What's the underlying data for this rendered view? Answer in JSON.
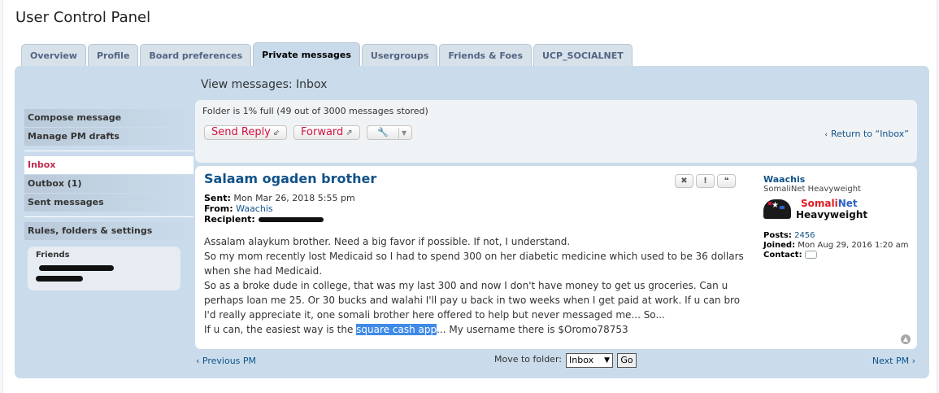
{
  "page": {
    "title": "User Control Panel"
  },
  "tabs": [
    {
      "label": "Overview"
    },
    {
      "label": "Profile"
    },
    {
      "label": "Board preferences"
    },
    {
      "label": "Private messages",
      "active": true
    },
    {
      "label": "Usergroups"
    },
    {
      "label": "Friends & Foes"
    },
    {
      "label": "UCP_SOCIALNET"
    }
  ],
  "sidebar": {
    "items": [
      {
        "label": "Compose message"
      },
      {
        "label": "Manage PM drafts"
      },
      {
        "label": "Inbox",
        "active": true
      },
      {
        "label": "Outbox (1)"
      },
      {
        "label": "Sent messages"
      },
      {
        "label": "Rules, folders & settings"
      }
    ],
    "friends_title": "Friends"
  },
  "main": {
    "view_title": "View messages: Inbox",
    "folder_status": "Folder is 1% full (49 out of 3000 messages stored)",
    "send_reply_label": "Send Reply",
    "forward_label": "Forward",
    "return_label": "Return to “Inbox”"
  },
  "message": {
    "subject": "Salaam ogaden brother",
    "sent_label": "Sent:",
    "sent_value": "Mon Mar 26, 2018 5:55 pm",
    "from_label": "From:",
    "from_value": "Waachis",
    "recipient_label": "Recipient:",
    "lines": [
      "Assalam alaykum brother. Need a big favor if possible. If not, I understand.",
      "So my mom recently lost Medicaid so I had to spend 300 on her diabetic medicine which used to be 36 dollars when she had Medicaid.",
      "So as a broke dude in college, that was my last 300 and now I don't have money to get us groceries. Can u perhaps loan me 25. Or 30 bucks and walahi I'll pay u back in two weeks when I get paid at work. If u can bro I'd really appreciate it, one somali brother here offered to help but never messaged me... So..."
    ],
    "last_line_before": "If u can, the easiest way is the ",
    "last_line_highlight": "square cash app",
    "last_line_after": "... My username there is $Oromo78753"
  },
  "profile": {
    "username": "Waachis",
    "rank": "SomaliNet Heavyweight",
    "rank_image_line1_a": "Somali",
    "rank_image_line1_b": "Net",
    "rank_image_line2": "Heavyweight",
    "posts_label": "Posts:",
    "posts_value": "2456",
    "joined_label": "Joined:",
    "joined_value": "Mon Aug 29, 2016 1:20 am",
    "contact_label": "Contact:"
  },
  "footer_nav": {
    "prev_label": "Previous PM",
    "next_label": "Next PM",
    "move_label": "Move to folder:",
    "move_selected": "Inbox",
    "go_label": "Go"
  },
  "colors": {
    "panel_bg": "#cadceb",
    "link": "#105289",
    "button_text": "#d31141",
    "active_sidebar": "#bc2a4d",
    "highlight": "#3f8ae8"
  }
}
